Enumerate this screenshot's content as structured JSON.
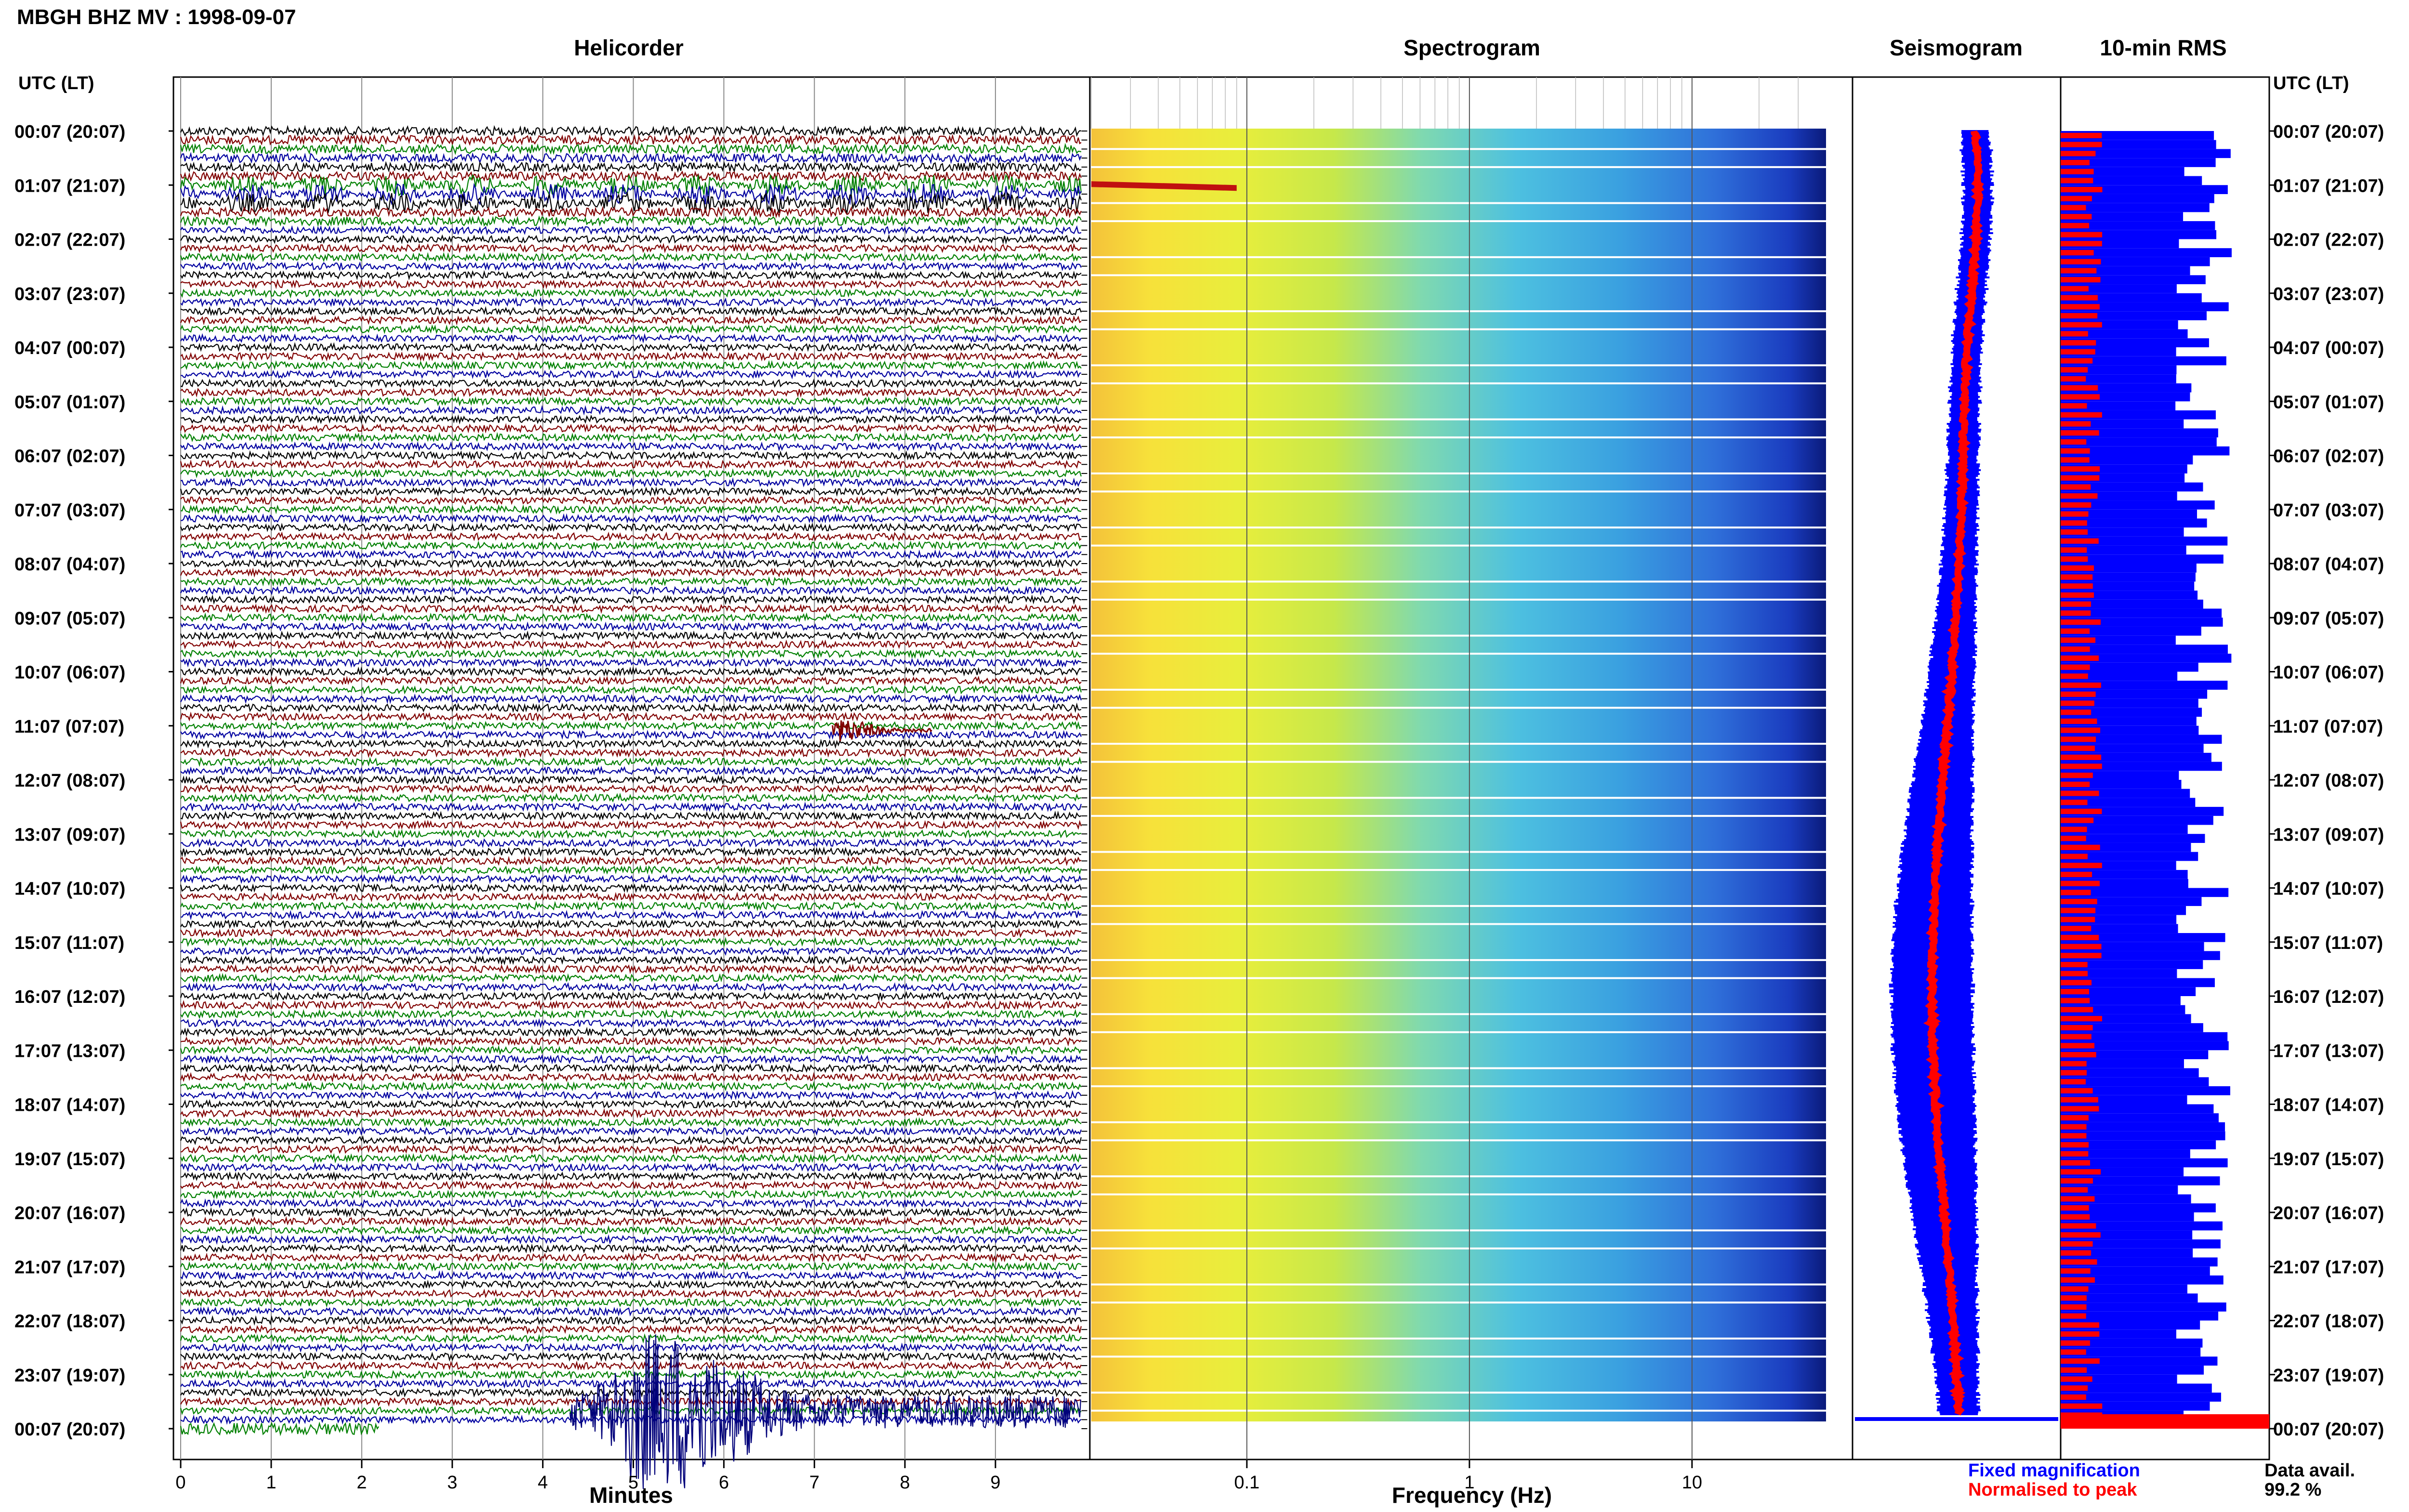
{
  "header": {
    "title": "MBGH BHZ MV : 1998-09-07"
  },
  "panels": {
    "helicorder": "Helicorder",
    "spectrogram": "Spectrogram",
    "seismogram": "Seismogram",
    "rms": "10-min RMS"
  },
  "axes": {
    "time_label": "UTC (LT)",
    "minutes_label": "Minutes",
    "frequency_label": "Frequency (Hz)"
  },
  "legend": {
    "fixed": "Fixed magnification",
    "normalised": "Normalised to peak",
    "fixed_color": "#0000ff",
    "normalised_color": "#ff0000"
  },
  "data_avail": {
    "label": "Data avail.",
    "value": "99.2 %"
  },
  "colors": {
    "trace_cycle": [
      "#000000",
      "#800000",
      "#008000",
      "#0000a0"
    ],
    "rms_blue": "#0000ff",
    "rms_red": "#ff0000",
    "spectro_colormap": "jet"
  },
  "chart_data": [
    {
      "type": "line",
      "name": "helicorder",
      "xlabel": "Minutes",
      "xlim": [
        0,
        10
      ],
      "xticks": [
        0,
        1,
        2,
        3,
        4,
        5,
        6,
        7,
        8,
        9
      ],
      "hour_labels": [
        "00:07 (20:07)",
        "01:07 (21:07)",
        "02:07 (22:07)",
        "03:07 (23:07)",
        "04:07 (00:07)",
        "05:07 (01:07)",
        "06:07 (02:07)",
        "07:07 (03:07)",
        "08:07 (04:07)",
        "09:07 (05:07)",
        "10:07 (06:07)",
        "11:07 (07:07)",
        "12:07 (08:07)",
        "13:07 (09:07)",
        "14:07 (10:07)",
        "15:07 (11:07)",
        "16:07 (12:07)",
        "17:07 (13:07)",
        "18:07 (14:07)",
        "19:07 (15:07)",
        "20:07 (16:07)",
        "21:07 (17:07)",
        "22:07 (18:07)",
        "23:07 (19:07)",
        "00:07 (20:07)"
      ],
      "traces_per_hour": 6,
      "notable_events": [
        {
          "time": "00:07",
          "note": "long-period oscillations"
        },
        {
          "time": "11:07",
          "minutes": [
            7.2,
            8.3
          ],
          "note": "dark red burst"
        },
        {
          "time": "23:07-00:07",
          "minutes": [
            4.3,
            10
          ],
          "note": "large event"
        }
      ]
    },
    {
      "type": "heatmap",
      "name": "spectrogram",
      "xlabel": "Frequency (Hz)",
      "xscale": "log",
      "xlim": [
        0.02,
        40
      ],
      "xticks": [
        0.1,
        1,
        10
      ],
      "colormap": "jet"
    },
    {
      "type": "line",
      "name": "seismogram",
      "series": [
        {
          "name": "Fixed magnification",
          "color": "#0000ff"
        },
        {
          "name": "Normalised to peak",
          "color": "#ff0000"
        }
      ]
    },
    {
      "type": "bar",
      "name": "10-min RMS",
      "orientation": "horizontal",
      "series": [
        {
          "color": "#0000ff",
          "value_range": [
            0.55,
            1.0
          ]
        },
        {
          "color": "#ff0000",
          "value_range": [
            0.12,
            0.2
          ]
        }
      ]
    }
  ]
}
